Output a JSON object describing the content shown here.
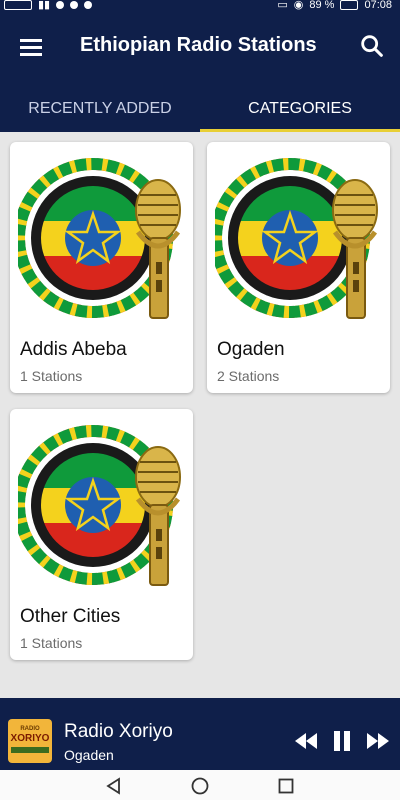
{
  "status_bar": {
    "battery": "89 %",
    "time": "07:08"
  },
  "app_bar": {
    "title": "Ethiopian Radio Stations",
    "menu_icon": "hamburger-menu-icon",
    "search_icon": "search-icon"
  },
  "tabs": [
    {
      "label": "RECENTLY ADDED",
      "active": false
    },
    {
      "label": "CATEGORIES",
      "active": true
    }
  ],
  "categories": [
    {
      "name": "Addis Abeba",
      "count": "1 Stations",
      "icon": "ethiopia-radio-microphone-logo"
    },
    {
      "name": "Ogaden",
      "count": "2 Stations",
      "icon": "ethiopia-radio-microphone-logo"
    },
    {
      "name": "Other Cities",
      "count": "1 Stations",
      "icon": "ethiopia-radio-microphone-logo"
    }
  ],
  "player": {
    "station": "Radio Xoriyo",
    "category": "Ogaden",
    "thumb_text_top": "RADIO",
    "thumb_text_main": "XORIYO"
  },
  "colors": {
    "app_bar": "#0f1f4a",
    "tab_indicator": "#e8cf36",
    "background": "#e6e6e6",
    "flag_green": "#0f9a3b",
    "flag_yellow": "#f4d21d",
    "flag_red": "#d9261c",
    "flag_blue": "#1f5fb0"
  }
}
